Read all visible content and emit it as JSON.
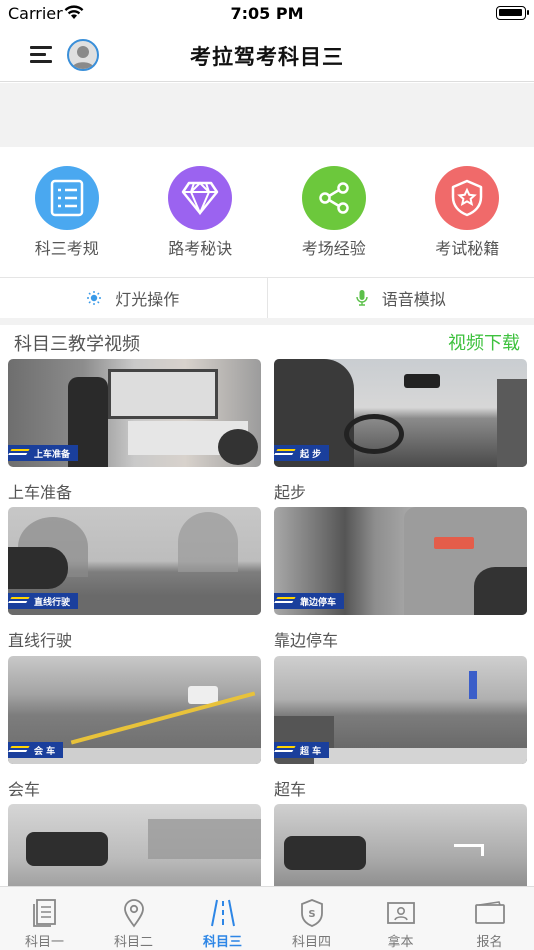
{
  "status_bar": {
    "carrier": "Carrier",
    "time": "7:05 PM"
  },
  "nav": {
    "title": "考拉驾考科目三"
  },
  "categories": [
    {
      "label": "科三考规",
      "color": "#4aa8f0",
      "icon": "checklist-icon"
    },
    {
      "label": "路考秘诀",
      "color": "#9b63f0",
      "icon": "diamond-icon"
    },
    {
      "label": "考场经验",
      "color": "#6cc83c",
      "icon": "share-icon"
    },
    {
      "label": "考试秘籍",
      "color": "#f06a6a",
      "icon": "star-shield-icon"
    }
  ],
  "quick_links": [
    {
      "label": "灯光操作",
      "icon": "light-icon"
    },
    {
      "label": "语音模拟",
      "icon": "mic-icon"
    }
  ],
  "section": {
    "title": "科目三教学视频",
    "download": "视频下载"
  },
  "videos": [
    {
      "name": "上车准备",
      "tag": "上车准备"
    },
    {
      "name": "起步",
      "tag": "起 步"
    },
    {
      "name": "直线行驶",
      "tag": "直线行驶"
    },
    {
      "name": "靠边停车",
      "tag": "靠边停车"
    },
    {
      "name": "会车",
      "tag": "会 车"
    },
    {
      "name": "超车",
      "tag": "超 车"
    },
    {
      "name": "",
      "tag": ""
    },
    {
      "name": "",
      "tag": ""
    }
  ],
  "tabs": [
    {
      "label": "科目一",
      "icon": "document-icon",
      "active": false
    },
    {
      "label": "科目二",
      "icon": "location-pin-icon",
      "active": false
    },
    {
      "label": "科目三",
      "icon": "road-icon",
      "active": true
    },
    {
      "label": "科目四",
      "icon": "shield-s-icon",
      "active": false
    },
    {
      "label": "拿本",
      "icon": "license-icon",
      "active": false
    },
    {
      "label": "报名",
      "icon": "card-icon",
      "active": false
    }
  ]
}
